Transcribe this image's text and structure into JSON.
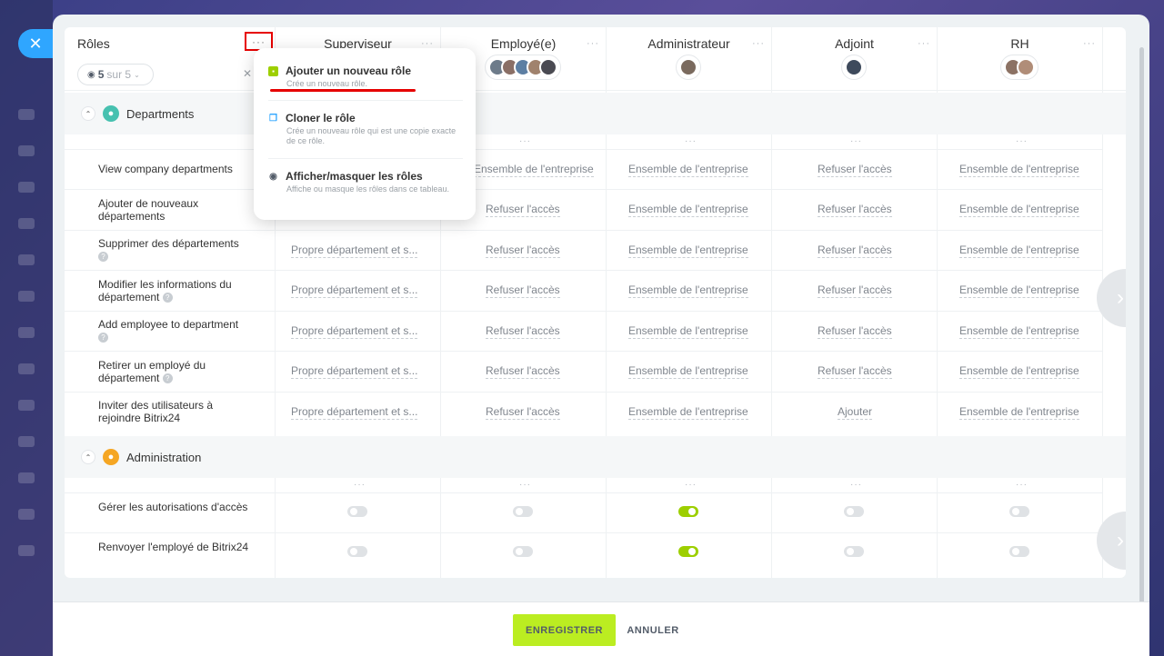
{
  "close_label": "✕",
  "roles_header": {
    "title": "Rôles",
    "menu_label": "···",
    "count_value": "5",
    "count_suffix": "sur 5",
    "collapse_label": "✕"
  },
  "columns": [
    {
      "name": "Superviseur",
      "dots": "···"
    },
    {
      "name": "Employé(e)",
      "dots": "···"
    },
    {
      "name": "Administrateur",
      "dots": "···"
    },
    {
      "name": "Adjoint",
      "dots": "···"
    },
    {
      "name": "RH",
      "dots": "···"
    }
  ],
  "sections": {
    "departments": {
      "title": "Departments",
      "rows": [
        {
          "label": "View company departments",
          "cells": [
            "",
            "Ensemble de l'entreprise",
            "Ensemble de l'entreprise",
            "Refuser l'accès",
            "Ensemble de l'entreprise"
          ]
        },
        {
          "label": "Ajouter de nouveaux départements",
          "cells": [
            "",
            "Refuser l'accès",
            "Ensemble de l'entreprise",
            "Refuser l'accès",
            "Ensemble de l'entreprise"
          ]
        },
        {
          "label": "Supprimer des départements",
          "cells": [
            "Propre département et s...",
            "Refuser l'accès",
            "Ensemble de l'entreprise",
            "Refuser l'accès",
            "Ensemble de l'entreprise"
          ]
        },
        {
          "label": "Modifier les informations du département",
          "cells": [
            "Propre département et s...",
            "Refuser l'accès",
            "Ensemble de l'entreprise",
            "Refuser l'accès",
            "Ensemble de l'entreprise"
          ]
        },
        {
          "label": "Add employee to department",
          "cells": [
            "Propre département et s...",
            "Refuser l'accès",
            "Ensemble de l'entreprise",
            "Refuser l'accès",
            "Ensemble de l'entreprise"
          ]
        },
        {
          "label": "Retirer un employé du département",
          "cells": [
            "Propre département et s...",
            "Refuser l'accès",
            "Ensemble de l'entreprise",
            "Refuser l'accès",
            "Ensemble de l'entreprise"
          ]
        },
        {
          "label": "Inviter des utilisateurs à rejoindre Bitrix24",
          "cells": [
            "Propre département et s...",
            "Refuser l'accès",
            "Ensemble de l'entreprise",
            "Ajouter",
            "Ensemble de l'entreprise"
          ]
        }
      ]
    },
    "administration": {
      "title": "Administration",
      "rows": [
        {
          "label": "Gérer les autorisations d'accès",
          "toggles": [
            false,
            false,
            true,
            false,
            false
          ]
        },
        {
          "label": "Renvoyer l'employé de Bitrix24",
          "toggles": [
            false,
            false,
            true,
            false,
            false
          ]
        }
      ]
    }
  },
  "context_menu": {
    "items": [
      {
        "title": "Ajouter un nouveau rôle",
        "desc": "Crée un nouveau rôle.",
        "icon": "add-role-icon"
      },
      {
        "title": "Cloner le rôle",
        "desc": "Crée un nouveau rôle qui est une copie exacte de ce rôle.",
        "icon": "clone-icon"
      },
      {
        "title": "Afficher/masquer les rôles",
        "desc": "Affiche ou masque les rôles dans ce tableau.",
        "icon": "eye-icon"
      }
    ]
  },
  "footer": {
    "save_label": "ENREGISTRER",
    "cancel_label": "ANNULER"
  },
  "colors": {
    "accent_green": "#bbed21",
    "toggle_on": "#9dcf00",
    "highlight_red": "#e60000",
    "close_blue": "#2fa6ff"
  }
}
